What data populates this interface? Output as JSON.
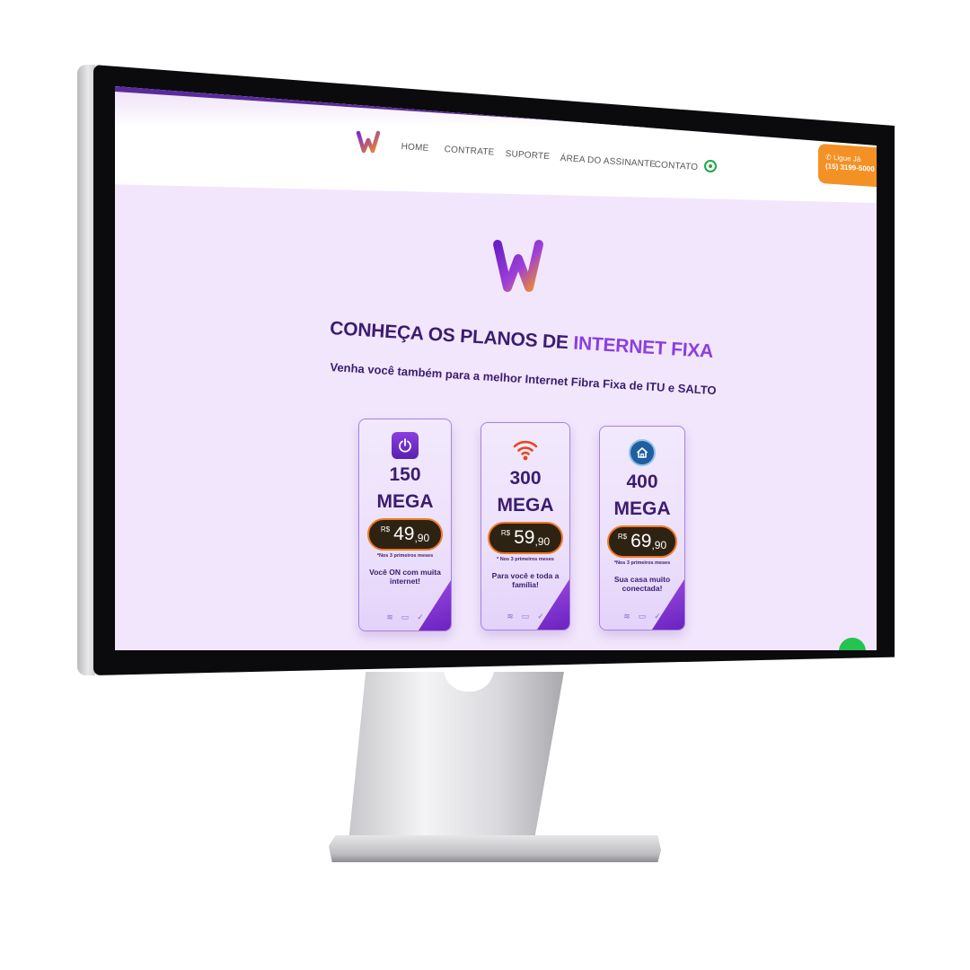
{
  "nav": {
    "items": [
      {
        "label": "HOME"
      },
      {
        "label": "CONTRATE"
      },
      {
        "label": "SUPORTE"
      },
      {
        "label": "ÁREA DO ASSINANTE"
      },
      {
        "label": "CONTATO"
      }
    ],
    "whatsapp_icon": "whatsapp-icon"
  },
  "ligue": {
    "label": "Ligue Já",
    "phone": "(15) 3199-5000"
  },
  "hero": {
    "title_main": "CONHEÇA OS PLANOS DE ",
    "title_accent": "INTERNET FIXA",
    "subtitle": "Venha você também para a melhor Internet Fibra Fixa de ITU e SALTO"
  },
  "plans": [
    {
      "speed": "150",
      "unit": "MEGA",
      "currency": "R$",
      "price_int": "49",
      "price_dec": ",90",
      "note": "*Nos 3 primeiros meses",
      "desc": "Você ON com muita internet!",
      "icon": "power-icon"
    },
    {
      "speed": "300",
      "unit": "MEGA",
      "currency": "R$",
      "price_int": "59",
      "price_dec": ",90",
      "note": "* Nos 3 primeiros meses",
      "desc": "Para você e toda a família!",
      "icon": "wifi-icon"
    },
    {
      "speed": "400",
      "unit": "MEGA",
      "currency": "R$",
      "price_int": "69",
      "price_dec": ",90",
      "note": "*Nos 3 primeiros meses",
      "desc": "Sua casa muito conectada!",
      "icon": "home-icon"
    }
  ],
  "colors": {
    "brand_purple": "#3c1c70",
    "accent_purple": "#8a3fe0",
    "orange": "#f39124",
    "whatsapp": "#25c451"
  }
}
